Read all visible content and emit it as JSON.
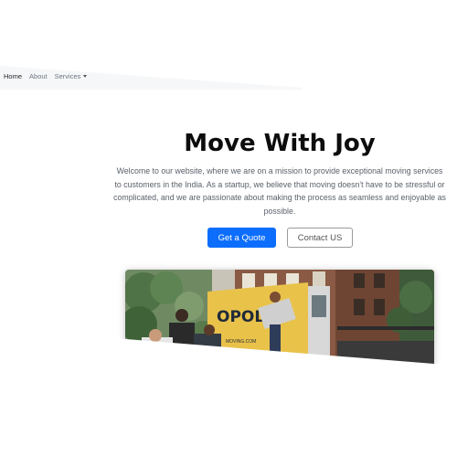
{
  "nav": {
    "items": [
      {
        "label": "Home",
        "active": true
      },
      {
        "label": "About",
        "active": false
      },
      {
        "label": "Services",
        "active": false,
        "dropdown": true
      }
    ]
  },
  "hero": {
    "title": "Move With Joy",
    "description": "Welcome to our website, where we are on a mission to provide exceptional moving services to customers in the India. As a startup, we believe that moving doesn't have to be stressful or complicated, and we are passionate about making the process as seamless and enjoyable as possible.",
    "primary_button": "Get a Quote",
    "secondary_button": "Contact US"
  },
  "image": {
    "truck_text": "OPOLIS",
    "truck_small_text": "MOVING.COM"
  },
  "colors": {
    "primary": "#0d6efd",
    "truck": "#f2c94c"
  }
}
